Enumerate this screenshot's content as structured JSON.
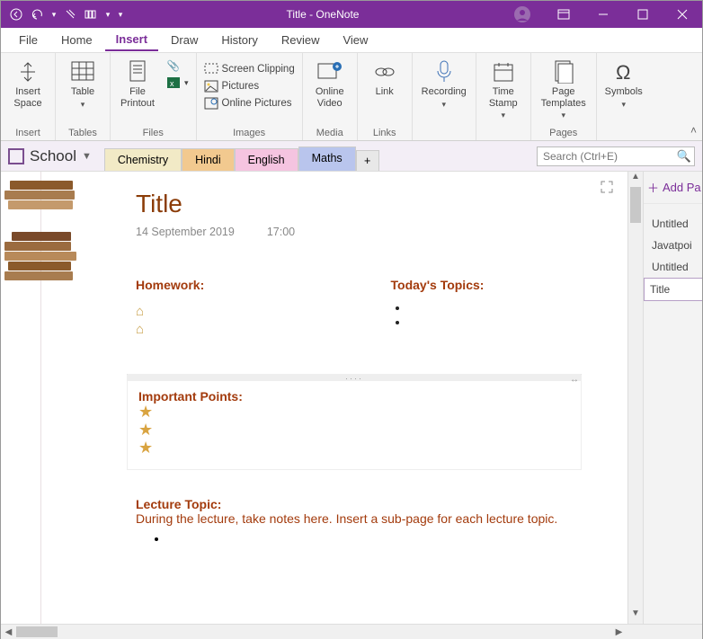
{
  "window": {
    "title": "Title  -  OneNote"
  },
  "menu": {
    "file": "File",
    "home": "Home",
    "insert": "Insert",
    "draw": "Draw",
    "history": "History",
    "review": "Review",
    "view": "View"
  },
  "ribbon": {
    "insert_space": "Insert\nSpace",
    "table": "Table",
    "file_printout": "File\nPrintout",
    "screen_clipping": "Screen Clipping",
    "pictures": "Pictures",
    "online_pictures": "Online Pictures",
    "online_video": "Online\nVideo",
    "link": "Link",
    "recording": "Recording",
    "time_stamp": "Time\nStamp",
    "page_templates": "Page\nTemplates",
    "symbols": "Symbols",
    "groups": {
      "insert": "Insert",
      "tables": "Tables",
      "files": "Files",
      "images": "Images",
      "media": "Media",
      "links": "Links",
      "pages": "Pages"
    }
  },
  "notebook": {
    "name": "School",
    "tabs": {
      "chemistry": "Chemistry",
      "hindi": "Hindi",
      "english": "English",
      "maths": "Maths"
    },
    "search_placeholder": "Search (Ctrl+E)"
  },
  "page": {
    "title": "Title",
    "date": "14 September 2019",
    "time": "17:00",
    "homework_hd": "Homework:",
    "todays_hd": "Today's Topics:",
    "important_hd": "Important Points:",
    "lecture_hd": "Lecture Topic:",
    "lecture_body": "During the lecture, take notes here.  Insert a sub-page for each lecture topic."
  },
  "pagelist": {
    "add": "Add Pa",
    "items": [
      "Untitled",
      "Javatpoi",
      "Untitled",
      "Title"
    ]
  }
}
